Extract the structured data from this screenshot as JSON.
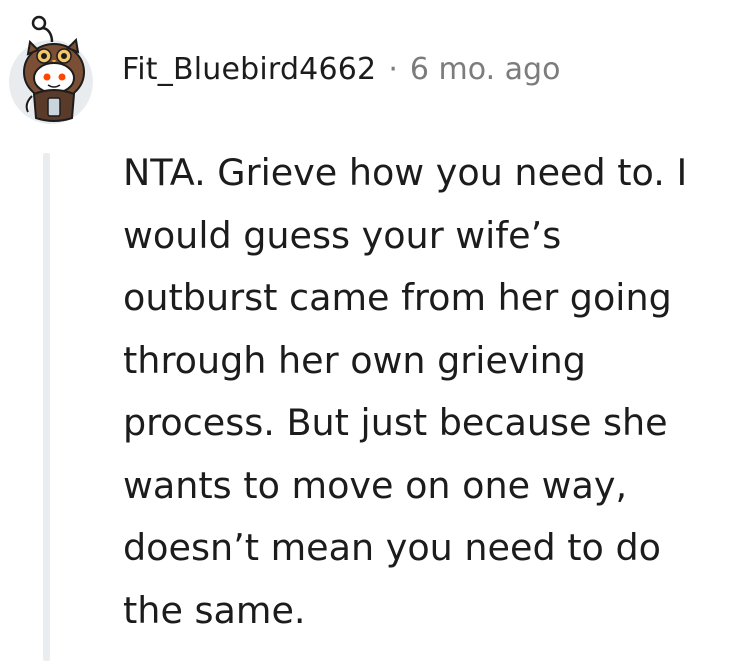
{
  "comment": {
    "author": "Fit_Bluebird4662",
    "separator": "·",
    "timestamp": "6 mo. ago",
    "avatar_icon": "reddit-snoo-owl-costume-avatar",
    "body_lines": [
      "NTA. Grieve how you need to. I",
      "would guess your wife’s",
      "outburst came from her going",
      "through her own grieving",
      "process. But just because she",
      "wants to move on one way,",
      "doesn’t mean you need to do",
      "the same."
    ]
  },
  "colors": {
    "text": "#1c1c1c",
    "meta": "#7c7c7c",
    "thread_line": "#eaedef",
    "avatar_bg": "#e9ecee",
    "owl_brown": "#7a4f36"
  }
}
